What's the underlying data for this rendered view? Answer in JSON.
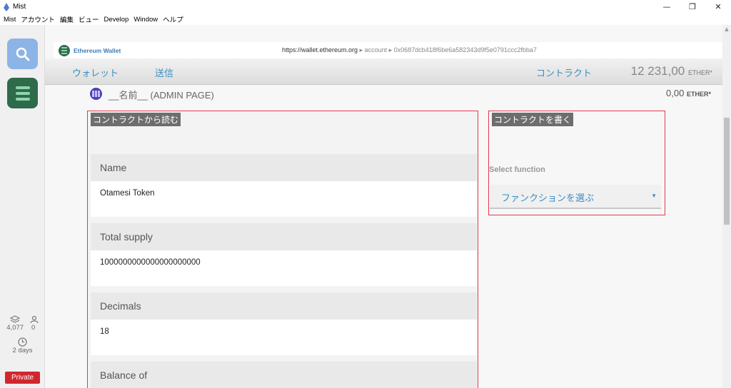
{
  "window": {
    "title": "Mist",
    "min": "—",
    "restore": "❐",
    "close": "✕"
  },
  "menu": [
    "Mist",
    "アカウント",
    "編集",
    "ビュー",
    "Develop",
    "Window",
    "ヘルプ"
  ],
  "sidebar": {
    "peers_count": "4,077",
    "peers_icon": "layers-icon",
    "users_count": "0",
    "users_icon": "users-icon",
    "last_block": "2 days",
    "network": "Private"
  },
  "urlbar": {
    "app_name": "Ethereum Wallet",
    "host": "https://wallet.ethereum.org",
    "sep1": "▸",
    "path1": "account",
    "sep2": "▸",
    "address": "0x0687dcb418f6be6a582343d9f5e0791ccc2fbba7"
  },
  "nav": {
    "wallets": "ウォレット",
    "send": "送信",
    "contracts": "コントラクト",
    "balance": "12 231,00",
    "unit": "ETHER*"
  },
  "account": {
    "name": "__名前__ (ADMIN PAGE)",
    "balance": "0,00",
    "unit": "ETHER*"
  },
  "read_contract": {
    "title": "コントラクトから読む",
    "fields": [
      {
        "label": "Name",
        "value": "Otamesi Token"
      },
      {
        "label": "Total supply",
        "value": "1000000000000000000000"
      },
      {
        "label": "Decimals",
        "value": "18"
      },
      {
        "label": "Balance of",
        "value": ""
      }
    ]
  },
  "write_contract": {
    "title": "コントラクトを書く",
    "select_label": "Select function",
    "select_value": "ファンクションを選ぶ"
  },
  "colors": {
    "accent": "#3a8ec6",
    "highlight_border": "#e6394d",
    "private_badge": "#d0272e"
  }
}
